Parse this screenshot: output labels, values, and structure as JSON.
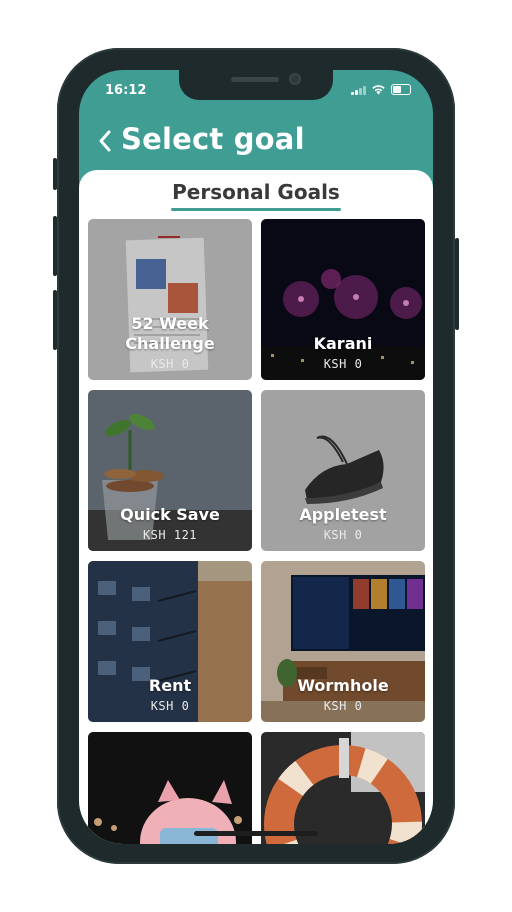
{
  "status_bar": {
    "time": "16:12"
  },
  "header": {
    "title": "Select goal",
    "back_icon": "chevron-left-icon",
    "background": "#3f9d93"
  },
  "tabs": {
    "active_label": "Personal Goals",
    "accent": "#3f9d93"
  },
  "goals": [
    {
      "name": "52 Week\nChallenge",
      "amount": "KSH 0"
    },
    {
      "name": "Karani",
      "amount": "KSH 0"
    },
    {
      "name": "Quick Save",
      "amount": "KSH 121"
    },
    {
      "name": "Appletest",
      "amount": "KSH 0"
    },
    {
      "name": "Rent",
      "amount": "KSH 0"
    },
    {
      "name": "Wormhole",
      "amount": "KSH 0"
    },
    {
      "name": "",
      "amount": ""
    },
    {
      "name": "",
      "amount": ""
    }
  ]
}
